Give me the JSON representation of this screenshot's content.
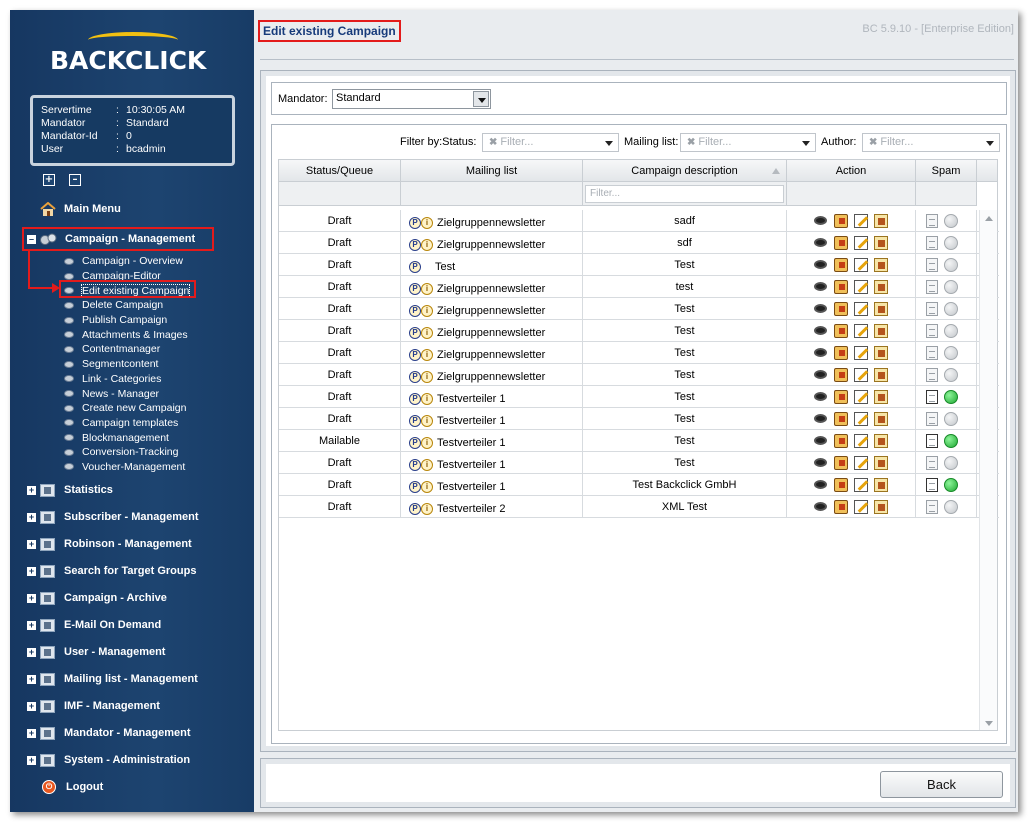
{
  "app": {
    "logo_text": "BACKCLICK",
    "version": "BC 5.9.10 - [Enterprise Edition]",
    "brand_color": "#1d4470",
    "accent_color": "#f2c011",
    "highlight_color": "#e31b1b"
  },
  "server_info": [
    {
      "key": "Servertime",
      "value": "10:30:05 AM"
    },
    {
      "key": "Mandator",
      "value": "Standard"
    },
    {
      "key": "Mandator-Id",
      "value": "0"
    },
    {
      "key": "User",
      "value": "bcadmin"
    }
  ],
  "server_sep": ":",
  "tree_controls": {
    "expand": "+",
    "collapse": "–"
  },
  "nav": {
    "main_menu": "Main Menu",
    "campaign_management": "Campaign - Management",
    "campaign_sub": [
      "Campaign - Overview",
      "Campaign-Editor",
      "Edit existing Campaign",
      "Delete Campaign",
      "Publish Campaign",
      "Attachments & Images",
      "Contentmanager",
      "Segmentcontent",
      "Link - Categories",
      "News - Manager",
      "Create new Campaign",
      "Campaign templates",
      "Blockmanagement",
      "Conversion-Tracking",
      "Voucher-Management"
    ],
    "active_sub_index": 2,
    "sections": [
      "Statistics",
      "Subscriber - Management",
      "Robinson - Management",
      "Search for Target Groups",
      "Campaign - Archive",
      "E-Mail On Demand",
      "User - Management",
      "Mailing list - Management",
      "IMF - Management",
      "Mandator - Management",
      "System - Administration"
    ],
    "logout": "Logout"
  },
  "page": {
    "title": "Edit existing Campaign",
    "mandator_label": "Mandator:",
    "mandator_value": "Standard"
  },
  "filters": {
    "status_label": "Filter by:Status:",
    "mailing_label": "Mailing list:",
    "author_label": "Author:",
    "placeholder": "Filter..."
  },
  "table": {
    "columns": [
      "Status/Queue",
      "Mailing list",
      "Campaign description",
      "Action",
      "Spam"
    ],
    "desc_filter_placeholder": "Filter...",
    "rows": [
      {
        "status": "Draft",
        "list": "Zielgruppennewsletter",
        "desc": "sadf",
        "info": true,
        "spam": "none"
      },
      {
        "status": "Draft",
        "list": "Zielgruppennewsletter",
        "desc": "sdf",
        "info": true,
        "spam": "none"
      },
      {
        "status": "Draft",
        "list": "Test",
        "desc": "Test",
        "info": false,
        "spam": "none"
      },
      {
        "status": "Draft",
        "list": "Zielgruppennewsletter",
        "desc": "test",
        "info": true,
        "spam": "none"
      },
      {
        "status": "Draft",
        "list": "Zielgruppennewsletter",
        "desc": "Test",
        "info": true,
        "spam": "none"
      },
      {
        "status": "Draft",
        "list": "Zielgruppennewsletter",
        "desc": "Test",
        "info": true,
        "spam": "none"
      },
      {
        "status": "Draft",
        "list": "Zielgruppennewsletter",
        "desc": "Test",
        "info": true,
        "spam": "none"
      },
      {
        "status": "Draft",
        "list": "Zielgruppennewsletter",
        "desc": "Test",
        "info": true,
        "spam": "none"
      },
      {
        "status": "Draft",
        "list": "Testverteiler 1",
        "desc": "Test",
        "info": true,
        "spam": "green"
      },
      {
        "status": "Draft",
        "list": "Testverteiler 1",
        "desc": "Test",
        "info": true,
        "spam": "none"
      },
      {
        "status": "Mailable",
        "list": "Testverteiler 1",
        "desc": "Test",
        "info": true,
        "spam": "green"
      },
      {
        "status": "Draft",
        "list": "Testverteiler 1",
        "desc": "Test",
        "info": true,
        "spam": "none"
      },
      {
        "status": "Draft",
        "list": "Testverteiler 1",
        "desc": "Test Backclick GmbH",
        "info": true,
        "spam": "green"
      },
      {
        "status": "Draft",
        "list": "Testverteiler 2",
        "desc": "XML Test",
        "info": true,
        "spam": "none"
      }
    ]
  },
  "footer": {
    "back_label": "Back"
  }
}
